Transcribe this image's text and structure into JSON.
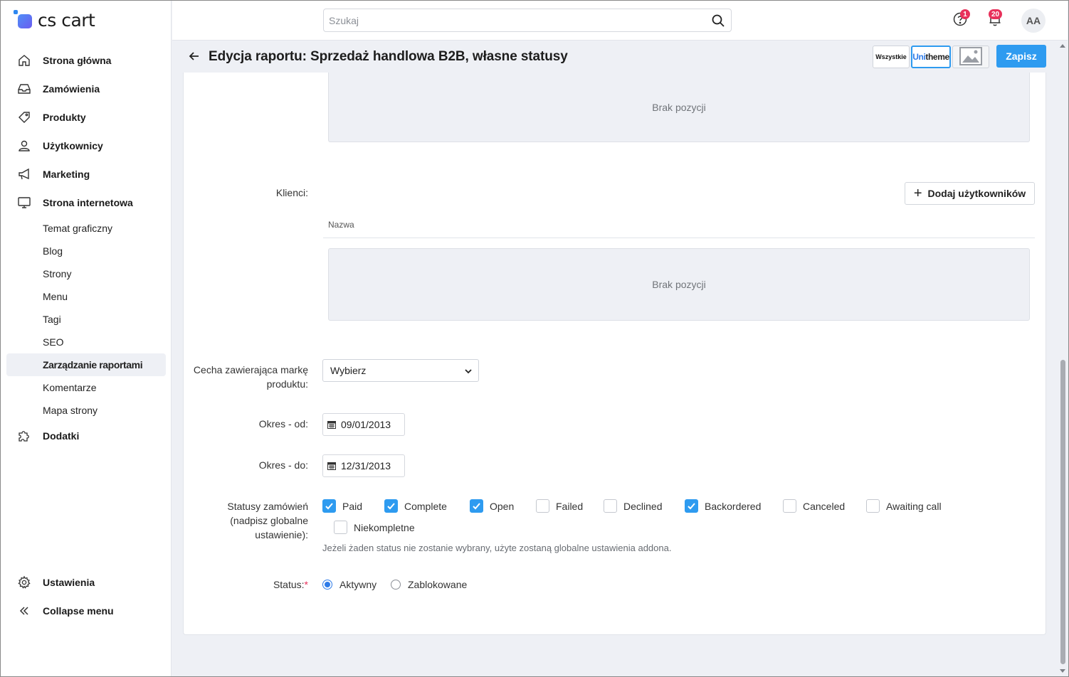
{
  "app": {
    "logo_text": "cs cart"
  },
  "sidebar": {
    "items": [
      {
        "label": "Strona główna",
        "icon": "home-icon"
      },
      {
        "label": "Zamówienia",
        "icon": "inbox-icon"
      },
      {
        "label": "Produkty",
        "icon": "tag-icon"
      },
      {
        "label": "Użytkownicy",
        "icon": "user-icon"
      },
      {
        "label": "Marketing",
        "icon": "megaphone-icon"
      },
      {
        "label": "Strona internetowa",
        "icon": "monitor-icon"
      }
    ],
    "subitems": [
      {
        "label": "Temat graficzny"
      },
      {
        "label": "Blog"
      },
      {
        "label": "Strony"
      },
      {
        "label": "Menu"
      },
      {
        "label": "Tagi"
      },
      {
        "label": "SEO"
      },
      {
        "label": "Zarządzanie raportami",
        "active": true
      },
      {
        "label": "Komentarze"
      },
      {
        "label": "Mapa strony"
      }
    ],
    "addons": {
      "label": "Dodatki",
      "icon": "puzzle-icon"
    },
    "settings": {
      "label": "Ustawienia",
      "icon": "gear-icon"
    },
    "collapse": {
      "label": "Collapse menu",
      "icon": "double-chevron-left-icon"
    }
  },
  "topbar": {
    "search_placeholder": "Szukaj",
    "help_badge": "1",
    "notifications_badge": "20",
    "avatar_initials": "AA"
  },
  "header": {
    "title": "Edycja raportu: Sprzedaż handlowa B2B, własne statusy",
    "btn_all": "Wszystkie",
    "btn_unitheme_prefix": "Uni",
    "btn_unitheme_suffix": "theme",
    "save_label": "Zapisz"
  },
  "form": {
    "empty_text_1": "Brak pozycji",
    "clients_label": "Klienci:",
    "add_users_label": "Dodaj użytkowników",
    "name_column": "Nazwa",
    "empty_text_2": "Brak pozycji",
    "brand_feature_label": "Cecha zawierająca markę produktu:",
    "brand_feature_value": "Wybierz",
    "period_from_label": "Okres - od:",
    "period_from_value": "09/01/2013",
    "period_to_label": "Okres - do:",
    "period_to_value": "12/31/2013",
    "statuses_label": "Statusy zamówień (nadpisz globalne ustawienie):",
    "statuses": [
      {
        "label": "Paid",
        "checked": true
      },
      {
        "label": "Complete",
        "checked": true
      },
      {
        "label": "Open",
        "checked": true
      },
      {
        "label": "Failed",
        "checked": false
      },
      {
        "label": "Declined",
        "checked": false
      },
      {
        "label": "Backordered",
        "checked": true
      },
      {
        "label": "Canceled",
        "checked": false
      },
      {
        "label": "Awaiting call",
        "checked": false
      },
      {
        "label": "Niekompletne",
        "checked": false
      }
    ],
    "statuses_hint": "Jeżeli żaden status nie zostanie wybrany, użyte zostaną globalne ustawienia addona.",
    "status_label": "Status:",
    "status_required_mark": "*",
    "status_options": [
      {
        "label": "Aktywny",
        "selected": true
      },
      {
        "label": "Zablokowane",
        "selected": false
      }
    ]
  },
  "colors": {
    "accent": "#2e9bf0",
    "badge": "#e8315b",
    "background": "#eef0f5"
  }
}
